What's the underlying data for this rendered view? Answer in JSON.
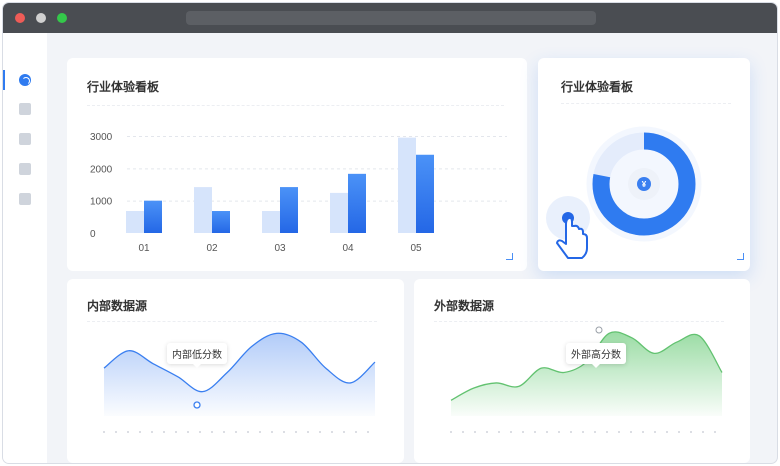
{
  "colors": {
    "accent": "#2f7bf0",
    "accent_light": "#d6e4fb",
    "green": "#62c270",
    "titlebar": "#4a4d52"
  },
  "sidebar": {
    "items": [
      {
        "icon": "dashboard-icon",
        "active": true
      },
      {
        "icon": "camera-icon",
        "active": false
      },
      {
        "icon": "trend-chart-icon",
        "active": false
      },
      {
        "icon": "add-user-icon",
        "active": false
      },
      {
        "icon": "document-icon",
        "active": false
      }
    ]
  },
  "cards": {
    "bar": {
      "title": "行业体验看板"
    },
    "donut": {
      "title": "行业体验看板",
      "center_symbol": "¥",
      "pointer_icon": "hand-pointer-icon"
    },
    "internal": {
      "title": "内部数据源",
      "tooltip": "内部低分数"
    },
    "external": {
      "title": "外部数据源",
      "tooltip": "外部高分数"
    }
  },
  "chart_data": [
    {
      "type": "bar",
      "categories": [
        "01",
        "02",
        "03",
        "04",
        "05"
      ],
      "yticks": [
        "0",
        "1000",
        "2000",
        "3000"
      ],
      "ylim": [
        0,
        3000
      ],
      "series": [
        {
          "values": [
            680,
            1420,
            680,
            1240,
            2950
          ]
        },
        {
          "values": [
            1000,
            680,
            1420,
            1830,
            2420
          ]
        }
      ],
      "title": "行业体验看板"
    },
    {
      "type": "pie",
      "values": [
        78,
        22
      ],
      "title": "行业体验看板"
    },
    {
      "type": "area",
      "title": "内部数据源",
      "annotations": [
        "内部低分数"
      ],
      "series": [
        {
          "values": [
            0.55,
            0.75,
            0.6,
            0.45,
            0.28,
            0.5,
            0.8,
            0.95,
            0.85,
            0.55,
            0.38,
            0.62
          ]
        }
      ]
    },
    {
      "type": "area",
      "title": "外部数据源",
      "annotations": [
        "外部高分数"
      ],
      "series": [
        {
          "values": [
            0.18,
            0.32,
            0.38,
            0.34,
            0.55,
            0.5,
            0.62,
            0.95,
            0.9,
            0.72,
            0.85,
            0.92,
            0.5
          ]
        }
      ]
    }
  ]
}
